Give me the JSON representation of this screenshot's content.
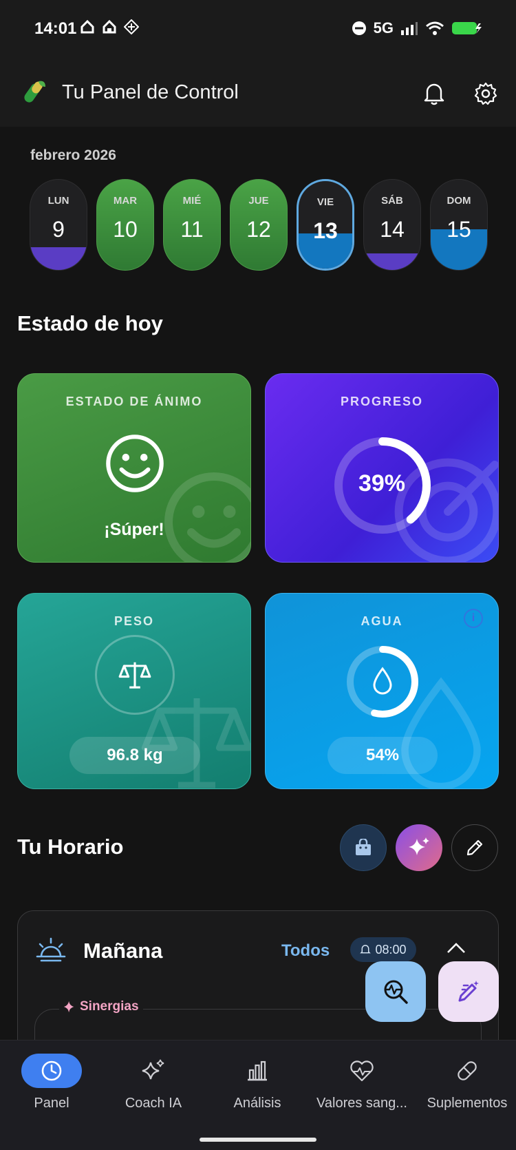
{
  "status_bar": {
    "time": "14:01",
    "network": "5G"
  },
  "header": {
    "title": "Tu Panel de Control"
  },
  "calendar": {
    "month": "febrero 2026",
    "days": [
      {
        "name": "LUN",
        "date": "9",
        "fill": 0.25,
        "fill_color": "#5a3dc4"
      },
      {
        "name": "MAR",
        "date": "10",
        "fill": 1,
        "fill_color": "#3d8f3c"
      },
      {
        "name": "MIÉ",
        "date": "11",
        "fill": 1,
        "fill_color": "#3d8f3c"
      },
      {
        "name": "JUE",
        "date": "12",
        "fill": 1,
        "fill_color": "#3d8f3c"
      },
      {
        "name": "VIE",
        "date": "13",
        "fill": 0.4,
        "fill_color": "#1377bf"
      },
      {
        "name": "SÁB",
        "date": "14",
        "fill": 0.18,
        "fill_color": "#5a3dc4"
      },
      {
        "name": "DOM",
        "date": "15",
        "fill": 0.45,
        "fill_color": "#1377bf"
      }
    ]
  },
  "today": {
    "title": "Estado de hoy",
    "mood": {
      "label": "ESTADO DE ÁNIMO",
      "value": "¡Súper!"
    },
    "progress": {
      "label": "PROGRESO",
      "value": "39%",
      "fraction": 0.39
    },
    "weight": {
      "label": "PESO",
      "value": "96.8 kg"
    },
    "water": {
      "label": "AGUA",
      "value": "54%",
      "fraction": 0.54
    }
  },
  "schedule": {
    "title": "Tu Horario",
    "section": {
      "name": "Mañana",
      "filter": "Todos",
      "time": "08:00",
      "group_label": "Sinergias"
    }
  },
  "nav": {
    "items": [
      {
        "label": "Panel",
        "icon": "clock-icon",
        "active": true
      },
      {
        "label": "Coach IA",
        "icon": "sparkles-icon"
      },
      {
        "label": "Análisis",
        "icon": "bar-chart-icon"
      },
      {
        "label": "Valores sang...",
        "icon": "heart-pulse-icon"
      },
      {
        "label": "Suplementos",
        "icon": "pill-icon"
      }
    ]
  },
  "colors": {
    "accent_blue": "#3f7ff0",
    "mood_green": "#3d8f3c",
    "progress_purple": "#5a2ee8",
    "weight_teal": "#1c907f",
    "water_blue": "#0a9ce4"
  }
}
